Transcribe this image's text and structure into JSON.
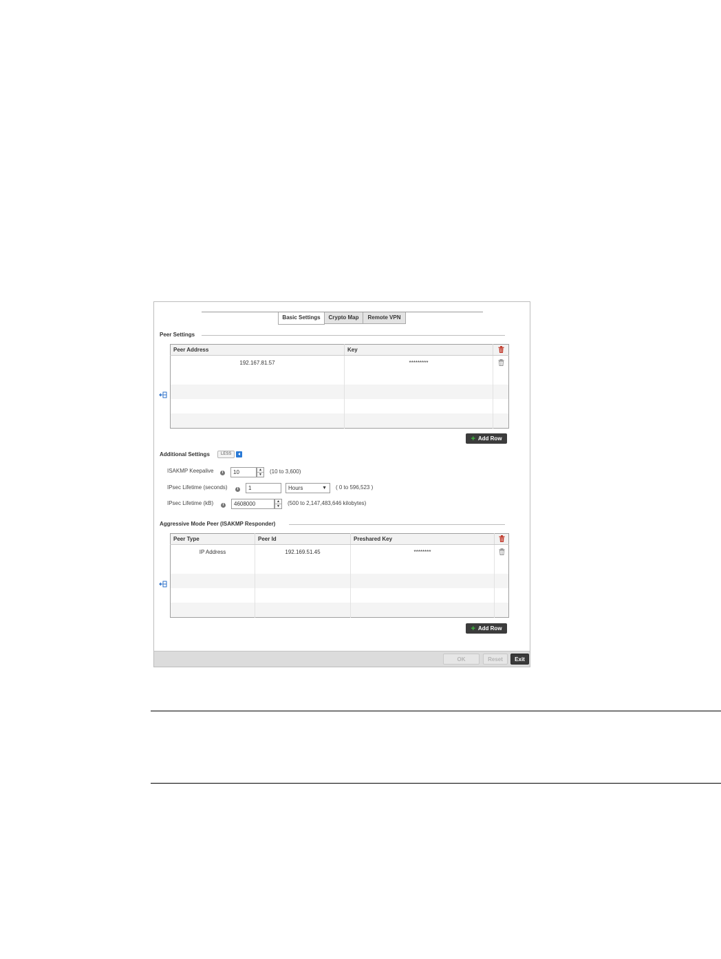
{
  "tabs": [
    {
      "label": "Basic Settings",
      "active": true
    },
    {
      "label": "Crypto Map",
      "active": false
    },
    {
      "label": "Remote VPN",
      "active": false
    }
  ],
  "peer_settings": {
    "title": "Peer Settings",
    "columns": [
      "Peer Address",
      "Key"
    ],
    "rows": [
      {
        "peer_address": "192.167.81.57",
        "key": "*********"
      }
    ],
    "add_row_label": "Add Row"
  },
  "additional_settings": {
    "title": "Additional Settings",
    "toggle_label": "LESS",
    "isakmp_keepalive": {
      "label": "ISAKMP Keepalive",
      "value": "10",
      "hint": "(10 to 3,600)"
    },
    "ipsec_lifetime_seconds": {
      "label": "IPsec Lifetime (seconds)",
      "value": "1",
      "unit": "Hours",
      "hint": "( 0 to 596,523 )"
    },
    "ipsec_lifetime_kb": {
      "label": "IPsec Lifetime (kB)",
      "value": "4608000",
      "hint": "(500 to 2,147,483,646 kilobytes)"
    }
  },
  "aggressive_mode": {
    "title": "Aggressive Mode Peer (ISAKMP Responder)",
    "columns": [
      "Peer Type",
      "Peer Id",
      "Preshared Key"
    ],
    "rows": [
      {
        "peer_type": "IP Address",
        "peer_id": "192.169.51.45",
        "preshared_key": "********"
      }
    ],
    "add_row_label": "Add Row"
  },
  "footer": {
    "ok_label": "OK",
    "reset_label": "Reset",
    "exit_label": "Exit"
  },
  "colors": {
    "trash_red": "#c0392b",
    "accent_blue": "#2a7ad6",
    "add_green": "#3fbf3f"
  },
  "icons": {
    "delete": "trash-icon",
    "side": "insert-row-icon",
    "info": "info-icon"
  }
}
